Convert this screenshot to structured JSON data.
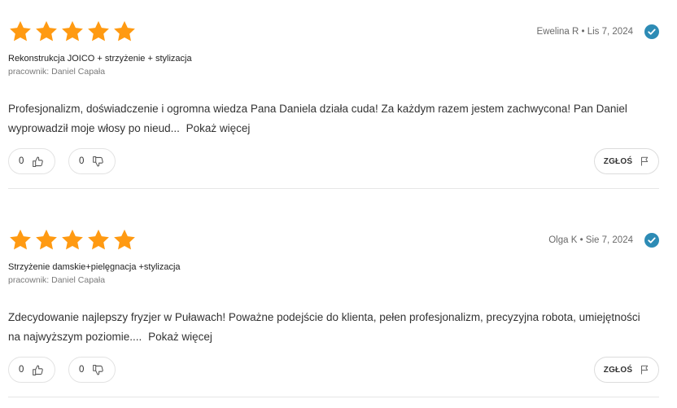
{
  "colors": {
    "star": "#ff9a12",
    "verified": "#2d8bb5",
    "divider": "#e6e6e6"
  },
  "reviews": [
    {
      "rating": 5,
      "author_date": "Ewelina R • Lis 7, 2024",
      "verified_icon": "check-circle-icon",
      "service": "Rekonstrukcja JOICO + strzyżenie + stylizacja",
      "employee": "pracownik: Daniel Capała",
      "text": "Profesjonalizm, doświadczenie i ogromna wiedza Pana Daniela działa cuda! Za każdym razem jestem zachwycona! Pan Daniel wyprowadził moje włosy po nieud...",
      "show_more": "Pokaż więcej",
      "likes": "0",
      "dislikes": "0",
      "report": "ZGŁOŚ"
    },
    {
      "rating": 5,
      "author_date": "Olga K • Sie 7, 2024",
      "verified_icon": "check-circle-icon",
      "service": "Strzyżenie damskie+pielęgnacja +stylizacja",
      "employee": "pracownik: Daniel Capała",
      "text": "Zdecydowanie najlepszy fryzjer w Puławach! Poważne podejście do klienta, pełen profesjonalizm, precyzyjna robota, umiejętności na najwyższym poziomie....",
      "show_more": "Pokaż więcej",
      "likes": "0",
      "dislikes": "0",
      "report": "ZGŁOŚ"
    }
  ]
}
